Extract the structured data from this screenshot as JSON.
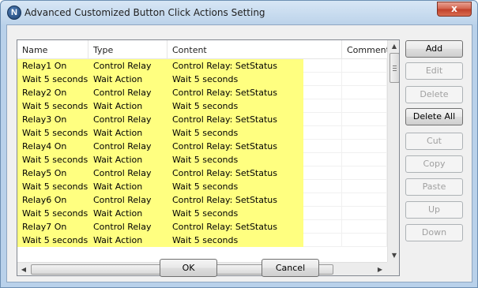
{
  "window": {
    "title": "Advanced Customized Button Click Actions Setting",
    "app_icon_letter": "N",
    "close_glyph": "x"
  },
  "table": {
    "columns": [
      "Name",
      "Type",
      "Content",
      "Comments"
    ],
    "rows": [
      {
        "name": "Relay1 On",
        "type": "Control Relay",
        "content": "Control Relay: SetStatus",
        "comments": ""
      },
      {
        "name": "Wait 5 seconds",
        "type": "Wait Action",
        "content": "Wait 5 seconds",
        "comments": ""
      },
      {
        "name": "Relay2 On",
        "type": "Control Relay",
        "content": "Control Relay: SetStatus",
        "comments": ""
      },
      {
        "name": "Wait 5 seconds",
        "type": "Wait Action",
        "content": "Wait 5 seconds",
        "comments": ""
      },
      {
        "name": "Relay3 On",
        "type": "Control Relay",
        "content": "Control Relay: SetStatus",
        "comments": ""
      },
      {
        "name": "Wait 5 seconds",
        "type": "Wait Action",
        "content": "Wait 5 seconds",
        "comments": ""
      },
      {
        "name": "Relay4 On",
        "type": "Control Relay",
        "content": "Control Relay: SetStatus",
        "comments": ""
      },
      {
        "name": "Wait 5 seconds",
        "type": "Wait Action",
        "content": "Wait 5 seconds",
        "comments": ""
      },
      {
        "name": "Relay5 On",
        "type": "Control Relay",
        "content": "Control Relay: SetStatus",
        "comments": ""
      },
      {
        "name": "Wait 5 seconds",
        "type": "Wait Action",
        "content": "Wait 5 seconds",
        "comments": ""
      },
      {
        "name": "Relay6 On",
        "type": "Control Relay",
        "content": "Control Relay: SetStatus",
        "comments": ""
      },
      {
        "name": "Wait 5 seconds",
        "type": "Wait Action",
        "content": "Wait 5 seconds",
        "comments": ""
      },
      {
        "name": "Relay7 On",
        "type": "Control Relay",
        "content": "Control Relay: SetStatus",
        "comments": ""
      },
      {
        "name": "Wait 5 seconds",
        "type": "Wait Action",
        "content": "Wait 5 seconds",
        "comments": ""
      }
    ],
    "highlight_color": "#ffff80"
  },
  "scrollbars": {
    "up_glyph": "▲",
    "down_glyph": "▼",
    "left_glyph": "◀",
    "right_glyph": "▶"
  },
  "side_buttons": [
    {
      "label": "Add",
      "enabled": true
    },
    {
      "label": "Edit",
      "enabled": false
    },
    {
      "label": "Delete",
      "enabled": false
    },
    {
      "label": "Delete All",
      "enabled": true
    },
    {
      "label": "Cut",
      "enabled": false
    },
    {
      "label": "Copy",
      "enabled": false
    },
    {
      "label": "Paste",
      "enabled": false
    },
    {
      "label": "Up",
      "enabled": false
    },
    {
      "label": "Down",
      "enabled": false
    }
  ],
  "footer": {
    "ok_label": "OK",
    "cancel_label": "Cancel"
  }
}
